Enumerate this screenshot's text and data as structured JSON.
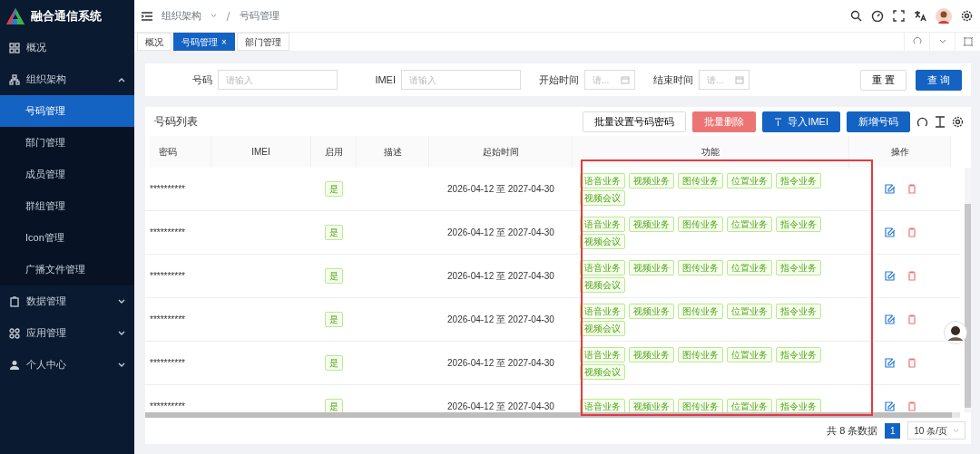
{
  "app": {
    "title": "融合通信系统"
  },
  "sidebar": {
    "items": [
      {
        "label": "概况"
      },
      {
        "label": "组织架构",
        "expanded": true,
        "children": [
          {
            "label": "号码管理",
            "selected": true
          },
          {
            "label": "部门管理",
            "selected": false
          },
          {
            "label": "成员管理",
            "selected": false
          },
          {
            "label": "群组管理",
            "selected": false
          },
          {
            "label": "Icon管理",
            "selected": false
          },
          {
            "label": "广播文件管理",
            "selected": false
          }
        ]
      },
      {
        "label": "数据管理",
        "expanded": false
      },
      {
        "label": "应用管理",
        "expanded": false
      },
      {
        "label": "个人中心",
        "expanded": false
      }
    ]
  },
  "breadcrumb": [
    "组织架构",
    "号码管理"
  ],
  "tabs": [
    {
      "label": "概况",
      "selected": false,
      "closable": false
    },
    {
      "label": "号码管理",
      "selected": true,
      "closable": true
    },
    {
      "label": "部门管理",
      "selected": false,
      "closable": false
    }
  ],
  "tab_close": "×",
  "filters": [
    {
      "label": "号码",
      "placeholder": "请输入",
      "kind": "text"
    },
    {
      "label": "IMEI",
      "placeholder": "请输入",
      "kind": "text"
    },
    {
      "label": "开始时间",
      "placeholder": "请...",
      "kind": "date"
    },
    {
      "label": "结束时间",
      "placeholder": "请...",
      "kind": "date"
    }
  ],
  "filter_buttons": [
    {
      "label": "重 置",
      "primary": false
    },
    {
      "label": "查 询",
      "primary": true
    }
  ],
  "table": {
    "title": "号码列表",
    "actions": [
      {
        "label": "批量设置号码密码",
        "kind": "default"
      },
      {
        "label": "批量删除",
        "kind": "danger"
      },
      {
        "label": "导入IMEI",
        "kind": "upload"
      },
      {
        "label": "新增号码",
        "kind": "primary"
      }
    ],
    "columns": [
      "密码",
      "IMEI",
      "启用",
      "描述",
      "起始时间",
      "功能",
      "操作"
    ],
    "rows": [
      {
        "password": "**********",
        "enabled": {
          "label": "是",
          "on": true
        },
        "period": "2026-04-12 至 2027-04-30",
        "features": [
          "语音业务",
          "视频业务",
          "图传业务",
          "位置业务",
          "指令业务",
          "视频会议"
        ]
      },
      {
        "password": "**********",
        "enabled": {
          "label": "是",
          "on": true
        },
        "period": "2026-04-12 至 2027-04-30",
        "features": [
          "语音业务",
          "视频业务",
          "图传业务",
          "位置业务",
          "指令业务",
          "视频会议"
        ]
      },
      {
        "password": "**********",
        "enabled": {
          "label": "是",
          "on": true
        },
        "period": "2026-04-12 至 2027-04-30",
        "features": [
          "语音业务",
          "视频业务",
          "图传业务",
          "位置业务",
          "指令业务",
          "视频会议"
        ]
      },
      {
        "password": "**********",
        "enabled": {
          "label": "是",
          "on": true
        },
        "period": "2026-04-12 至 2027-04-30",
        "features": [
          "语音业务",
          "视频业务",
          "图传业务",
          "位置业务",
          "指令业务",
          "视频会议"
        ]
      },
      {
        "password": "**********",
        "enabled": {
          "label": "是",
          "on": true
        },
        "period": "2026-04-12 至 2027-04-30",
        "features": [
          "语音业务",
          "视频业务",
          "图传业务",
          "位置业务",
          "指令业务",
          "视频会议"
        ]
      },
      {
        "password": "**********",
        "enabled": {
          "label": "是",
          "on": true
        },
        "period": "2026-04-12 至 2027-04-30",
        "features": [
          "语音业务",
          "视频业务",
          "图传业务",
          "位置业务",
          "指令业务"
        ]
      }
    ]
  },
  "pagination": {
    "total": "共 8 条数据",
    "pages": [
      {
        "label": "1",
        "selected": true
      }
    ],
    "page_size": "10 条/页"
  }
}
